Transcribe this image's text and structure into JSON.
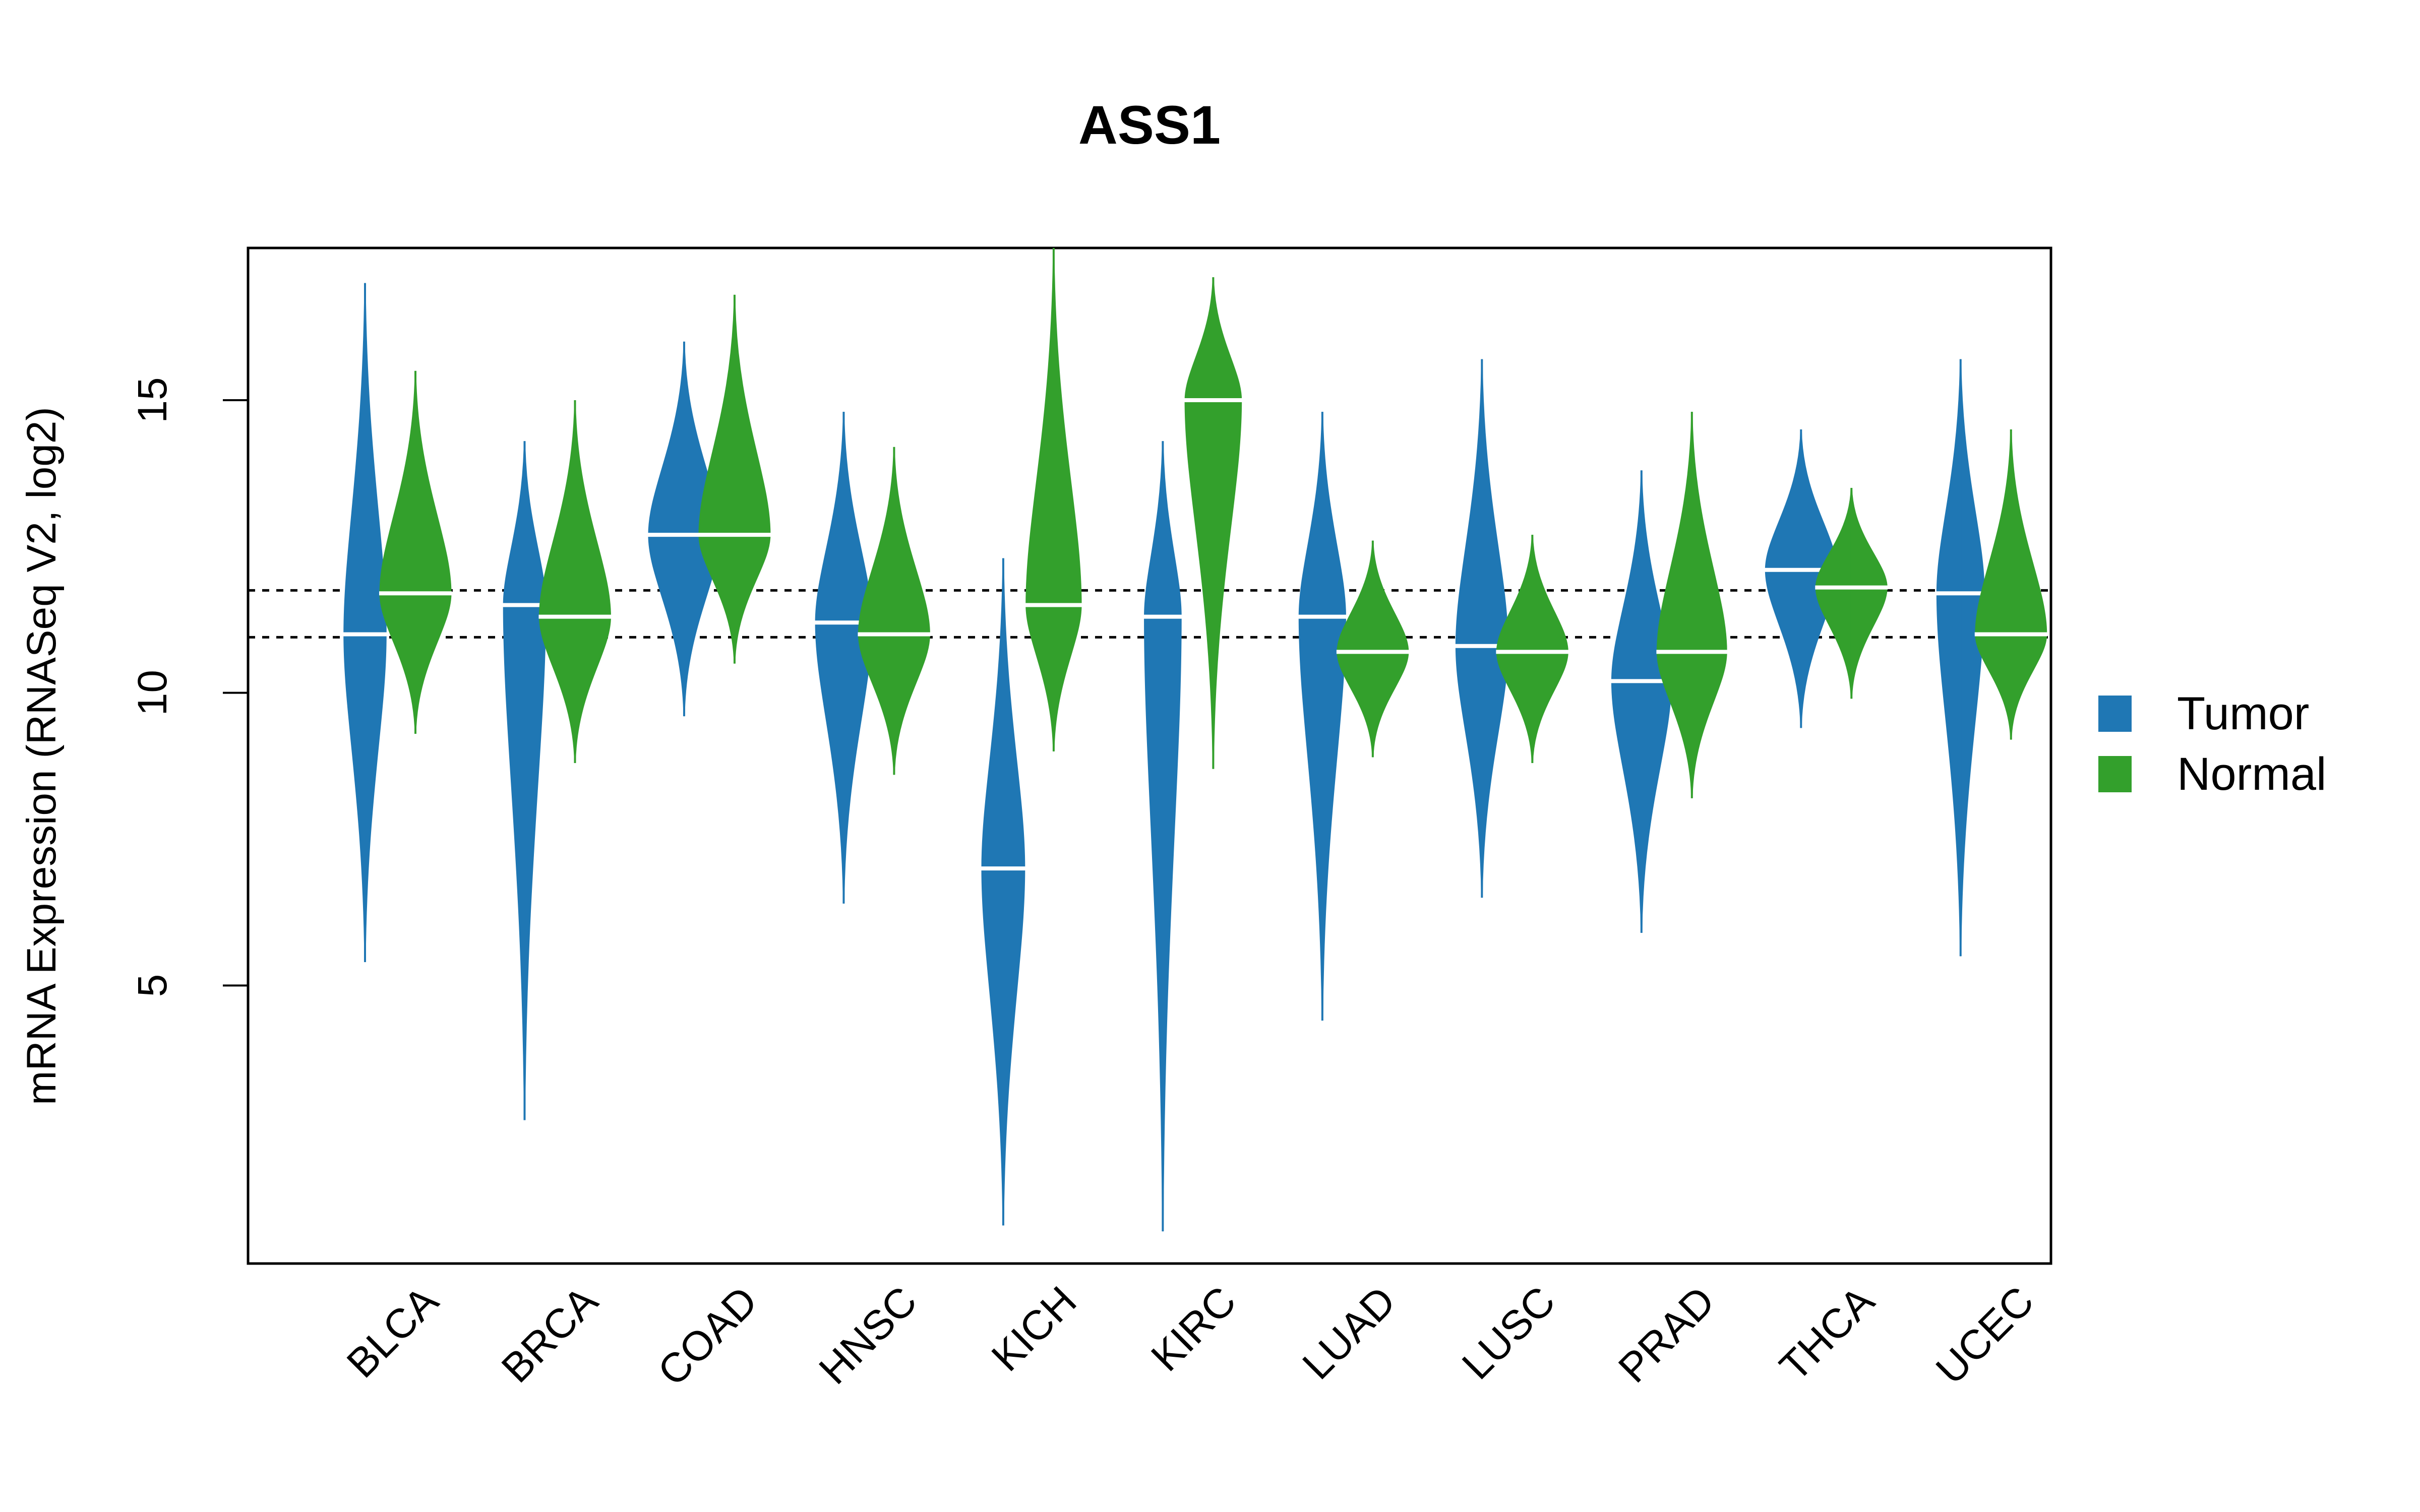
{
  "chart_data": {
    "type": "violin",
    "title": "ASS1",
    "xlabel": "",
    "ylabel": "mRNA Expression (RNASeq V2, log2)",
    "ylim": [
      0.25,
      17.6
    ],
    "yticks": [
      5,
      10,
      15
    ],
    "ytick_labels": [
      "5",
      "10",
      "15"
    ],
    "grid": false,
    "reference_lines": [
      11.75,
      10.95
    ],
    "legend": {
      "position": "right",
      "entries": [
        {
          "label": "Tumor",
          "color": "#1F77B4"
        },
        {
          "label": "Normal",
          "color": "#33A02C"
        }
      ]
    },
    "categories": [
      "BLCA",
      "BRCA",
      "COAD",
      "HNSC",
      "KICH",
      "KIRC",
      "LUAD",
      "LUSC",
      "PRAD",
      "THCA",
      "UCEC"
    ],
    "series": [
      {
        "name": "Tumor",
        "color": "#1F77B4",
        "median": [
          11.0,
          11.5,
          12.7,
          11.2,
          7.0,
          11.3,
          11.3,
          10.8,
          10.2,
          12.1,
          11.7
        ],
        "min": [
          5.4,
          2.7,
          9.6,
          6.4,
          0.9,
          0.8,
          4.4,
          6.5,
          5.9,
          9.4,
          5.5
        ],
        "max": [
          17.0,
          14.3,
          16.0,
          14.8,
          12.3,
          14.3,
          14.8,
          15.7,
          13.8,
          14.5,
          15.7
        ]
      },
      {
        "name": "Normal",
        "color": "#33A02C",
        "median": [
          11.7,
          11.3,
          12.7,
          11.0,
          11.5,
          15.0,
          10.7,
          10.7,
          10.7,
          11.8,
          11.0
        ],
        "min": [
          9.3,
          8.8,
          10.5,
          8.6,
          9.0,
          8.7,
          8.9,
          8.8,
          8.2,
          9.9,
          9.2
        ],
        "max": [
          15.5,
          15.0,
          16.8,
          14.2,
          17.6,
          17.1,
          12.6,
          12.7,
          14.8,
          13.5,
          14.5
        ]
      }
    ]
  }
}
